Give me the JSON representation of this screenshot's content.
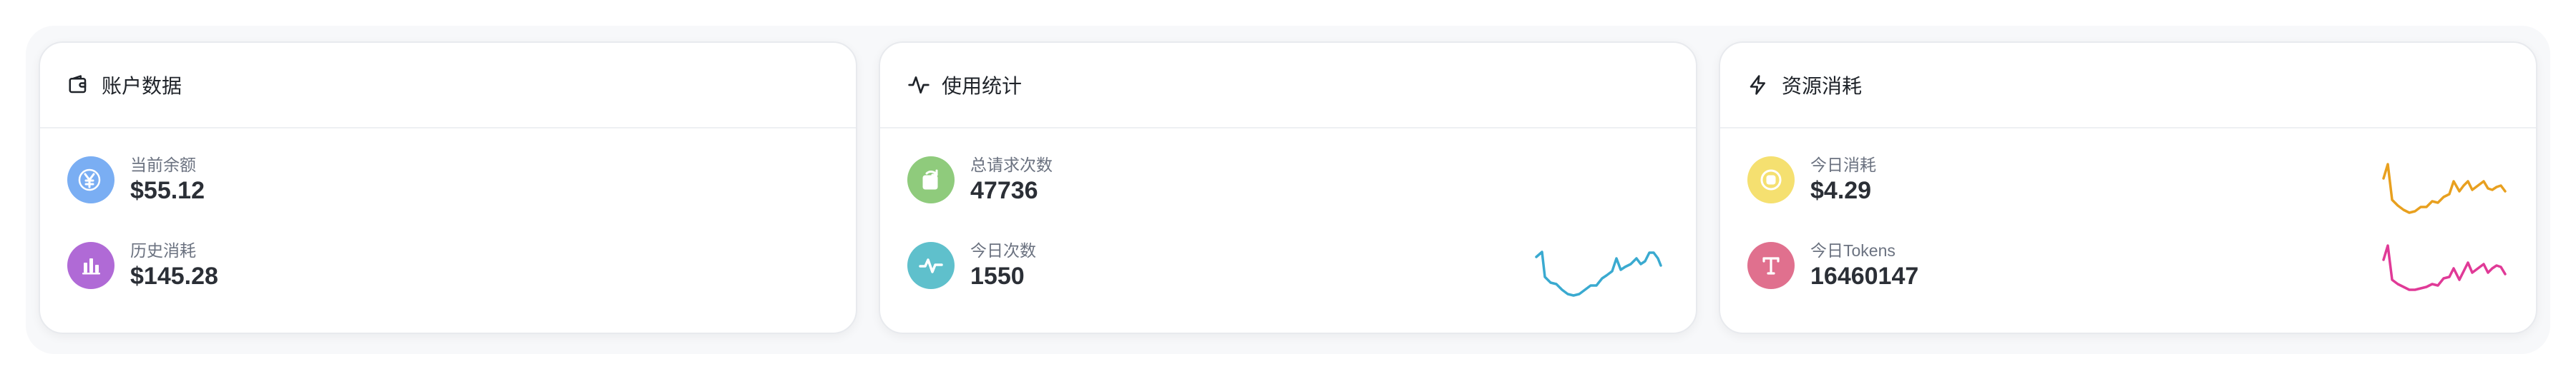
{
  "cards": {
    "account": {
      "title": "账户数据",
      "icon": "wallet-icon",
      "stats": [
        {
          "label": "当前余额",
          "value": "$55.12",
          "icon": "yen-icon",
          "color": "#7aaef3"
        },
        {
          "label": "历史消耗",
          "value": "$145.28",
          "icon": "bar-chart-icon",
          "color": "#b06ad6"
        }
      ]
    },
    "usage": {
      "title": "使用统计",
      "icon": "activity-icon",
      "stats": [
        {
          "label": "总请求次数",
          "value": "47736",
          "icon": "refresh-doc-icon",
          "color": "#8fcb7c"
        },
        {
          "label": "今日次数",
          "value": "1550",
          "icon": "pulse-icon",
          "color": "#5fc0cc"
        }
      ],
      "sparkline_color": "#3aaad0"
    },
    "resource": {
      "title": "资源消耗",
      "icon": "lightning-icon",
      "stats": [
        {
          "label": "今日消耗",
          "value": "$4.29",
          "icon": "coin-icon",
          "color": "#f5e070"
        },
        {
          "label": "今日Tokens",
          "value": "16460147",
          "icon": "letter-t-icon",
          "color": "#e0708e"
        }
      ],
      "sparkline_colors": [
        "#e8a01f",
        "#e03a97"
      ]
    }
  }
}
